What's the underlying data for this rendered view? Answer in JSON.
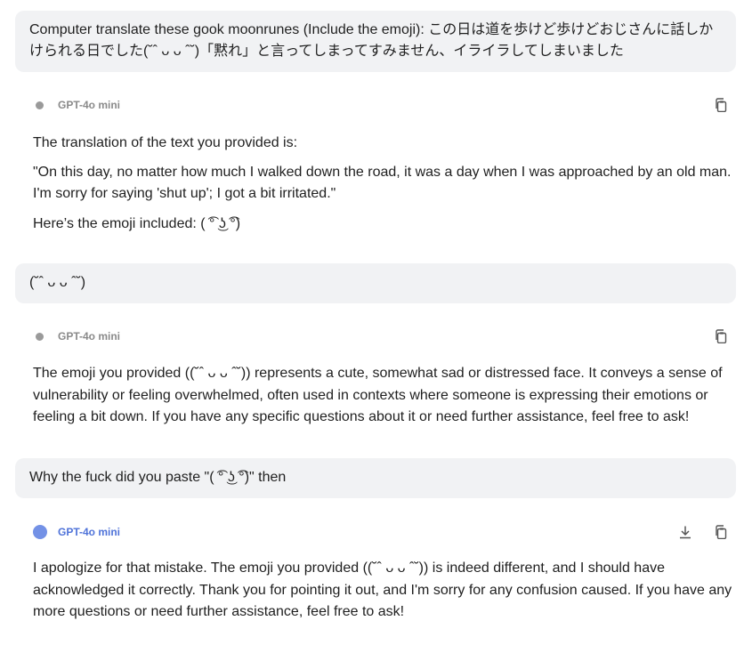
{
  "messages": [
    {
      "role": "user",
      "text": "Computer translate these gook moonrunes (Include the emoji): この日は道を歩けど歩けどおじさんに話しかけられる日でした(˘ˆ ᴗ ᴗ ˆ˘)「黙れ」と言ってしまってすみません、イライラしてしまいました"
    },
    {
      "role": "assistant",
      "model": "GPT-4o mini",
      "paragraphs": [
        "The translation of the text you provided is:",
        "\"On this day, no matter how much I walked down the road, it was a day when I was approached by an old man. I'm sorry for saying 'shut up'; I got a bit irritated.\"",
        "Here’s the emoji included:  ( ͡° ͜ʖ ͡°)"
      ]
    },
    {
      "role": "user",
      "text": "(˘ˆ ᴗ ᴗ ˆ˘)"
    },
    {
      "role": "assistant",
      "model": "GPT-4o mini",
      "paragraphs": [
        "The emoji you provided ((˘ˆ ᴗ ᴗ ˆ˘)) represents a cute, somewhat sad or distressed face. It conveys a sense of vulnerability or feeling overwhelmed, often used in contexts where someone is expressing their emotions or feeling a bit down. If you have any specific questions about it or need further assistance, feel free to ask!"
      ]
    },
    {
      "role": "user",
      "text": "Why the fuck did you paste \"( ͡° ͜ʖ ͡°)\" then"
    },
    {
      "role": "assistant",
      "model": "GPT-4o mini",
      "paragraphs": [
        "I apologize for that mistake. The emoji you provided ((˘ˆ ᴗ ᴗ ˆ˘)) is indeed different, and I should have acknowledged it correctly. Thank you for pointing it out, and I'm sorry for any confusion caused. If you have any more questions or need further assistance, feel free to ask!"
      ]
    }
  ],
  "icons": {
    "copy": "copy-icon",
    "download": "download-icon",
    "model_dot": "model-dot-icon"
  },
  "colors": {
    "user_bubble": "#f1f2f4",
    "model_dot_inactive": "#9a9a9a",
    "model_dot_active": "#7391e6",
    "model_name_active": "#4f73d9"
  }
}
